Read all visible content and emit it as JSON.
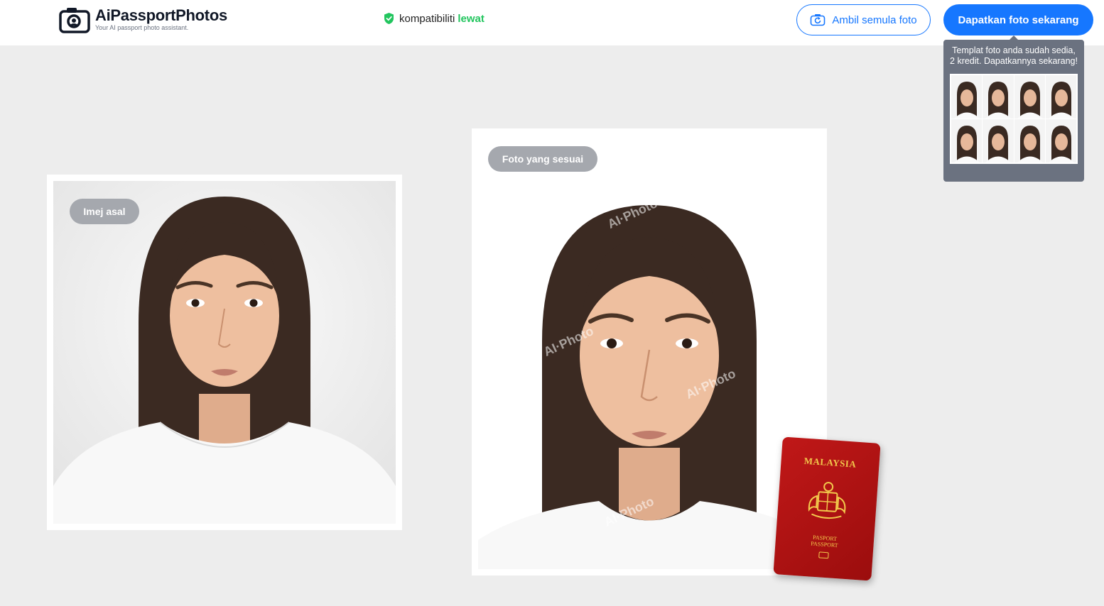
{
  "header": {
    "brand_name": "AiPassportPhotos",
    "brand_tagline": "Your AI passport photo assistant.",
    "compat_label": "kompatibiliti",
    "compat_status": "lewat",
    "retake_label": "Ambil semula foto",
    "get_label": "Dapatkan foto sekarang"
  },
  "tooltip": {
    "text": "Templat foto anda sudah sedia, 2 kredit. Dapatkannya sekarang!"
  },
  "original": {
    "badge": "Imej asal"
  },
  "result": {
    "badge": "Foto yang sesuai",
    "watermark": "AI·Photo"
  },
  "passport": {
    "country": "MALAYSIA",
    "type_ms": "PASPORT",
    "type_en": "PASSPORT"
  },
  "colors": {
    "primary": "#1677ff",
    "pass": "#22c55e",
    "badge": "#a5a8ae",
    "passport": "#b01414"
  }
}
